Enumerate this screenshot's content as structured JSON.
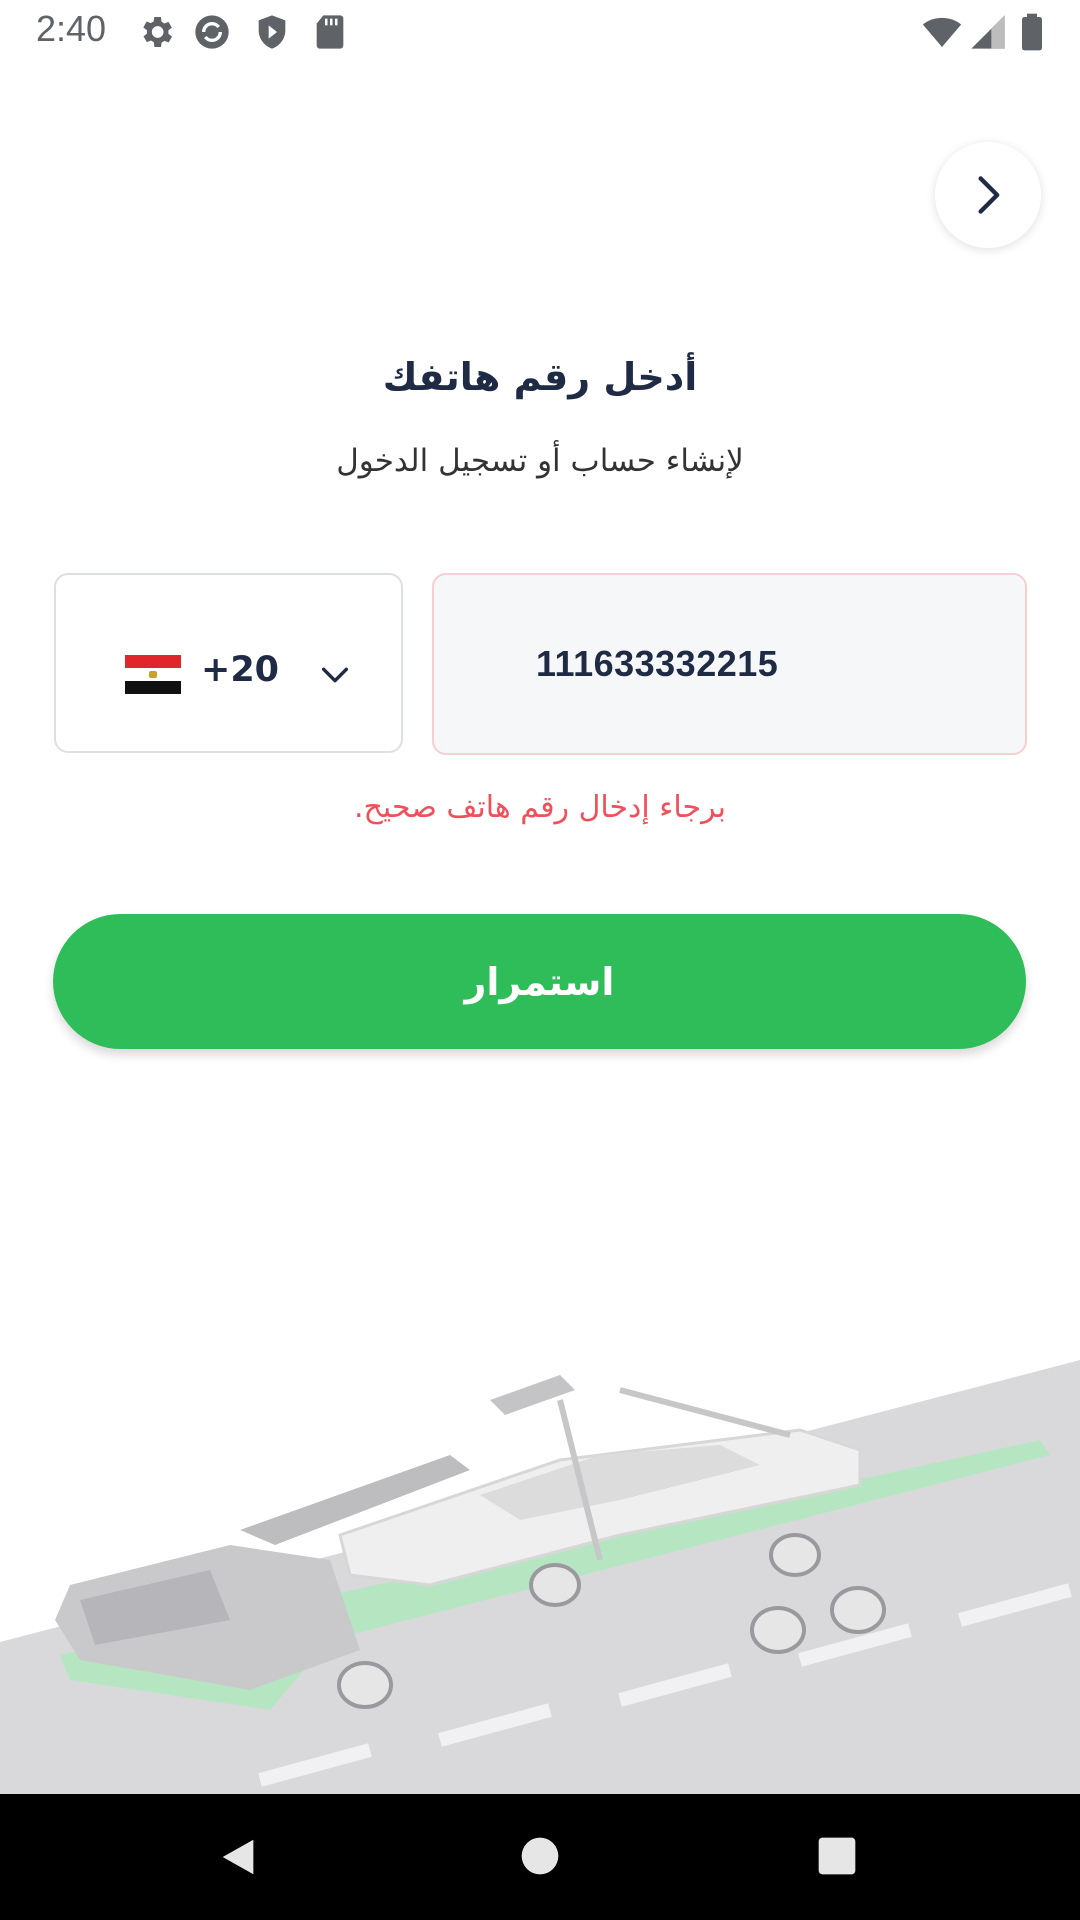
{
  "status_bar": {
    "time": "2:40",
    "icons_left": [
      "settings-icon",
      "sync-icon",
      "shield-play-icon",
      "sd-card-icon"
    ],
    "icons_right": [
      "wifi-icon",
      "cell-signal-icon",
      "battery-icon"
    ]
  },
  "header": {
    "back_icon": "chevron-right-icon"
  },
  "main": {
    "title": "أدخل رقم هاتفك",
    "subtitle": "لإنشاء حساب أو تسجيل الدخول",
    "country_selector": {
      "flag": "egypt-flag-icon",
      "code": "+20",
      "dropdown_icon": "chevron-down-icon"
    },
    "phone_input": {
      "value": "111633332215"
    },
    "error_message": "برجاء إدخال رقم هاتف صحيح.",
    "continue_button": "استمرار"
  },
  "colors": {
    "accent": "#2ebd59",
    "error": "#f0505a",
    "text_primary": "#1f2a44"
  },
  "nav_bar": {
    "items": [
      "back-icon",
      "home-icon",
      "recents-icon"
    ]
  }
}
